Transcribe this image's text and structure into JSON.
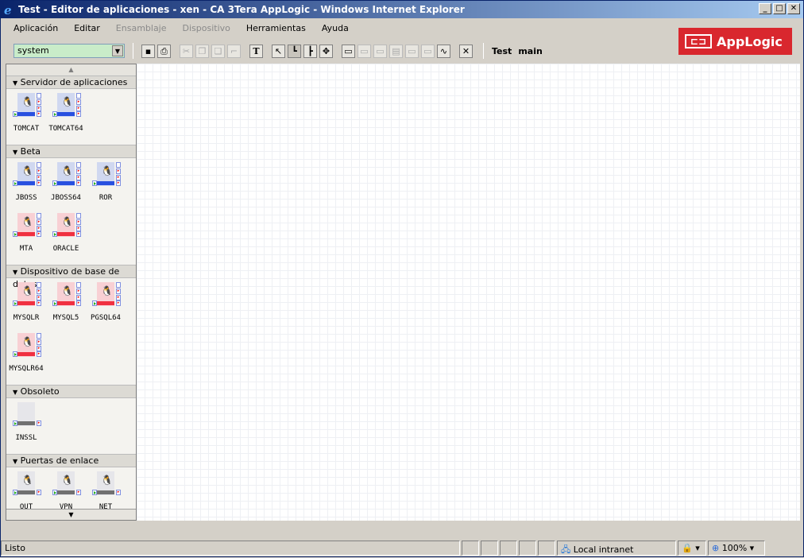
{
  "window": {
    "title": "Test - Editor de aplicaciones - xen - CA 3Tera AppLogic - Windows Internet Explorer",
    "minimize": "_",
    "maximize": "□",
    "close": "✕"
  },
  "menu": [
    {
      "label": "Aplicación",
      "enabled": true
    },
    {
      "label": "Editar",
      "enabled": true
    },
    {
      "label": "Ensamblaje",
      "enabled": false
    },
    {
      "label": "Dispositivo",
      "enabled": false
    },
    {
      "label": "Herramientas",
      "enabled": true
    },
    {
      "label": "Ayuda",
      "enabled": true
    }
  ],
  "logo": {
    "text": "AppLogic",
    "mark": "⊏⊟"
  },
  "toolbar": {
    "catalog_select": "system",
    "app_name": "Test",
    "assembly_name": "main"
  },
  "palette": {
    "sections": [
      {
        "title": "Servidor de aplicaciones",
        "items": [
          {
            "name": "TOMCAT",
            "color": "blue"
          },
          {
            "name": "TOMCAT64",
            "color": "blue"
          }
        ]
      },
      {
        "title": "Beta",
        "items": [
          {
            "name": "JBOSS",
            "color": "blue"
          },
          {
            "name": "JBOSS64",
            "color": "blue"
          },
          {
            "name": "ROR",
            "color": "blue"
          },
          {
            "name": "MTA",
            "color": "red"
          },
          {
            "name": "ORACLE",
            "color": "red"
          }
        ]
      },
      {
        "title": "Dispositivo de base de datos",
        "items": [
          {
            "name": "MYSQLR",
            "color": "red"
          },
          {
            "name": "MYSQL5",
            "color": "red"
          },
          {
            "name": "PGSQL64",
            "color": "red"
          },
          {
            "name": "MYSQLR64",
            "color": "red"
          }
        ]
      },
      {
        "title": "Obsoleto",
        "items": [
          {
            "name": "INSSL",
            "color": "gray"
          }
        ]
      },
      {
        "title": "Puertas de enlace",
        "items": [
          {
            "name": "OUT",
            "color": "gray"
          },
          {
            "name": "VPN",
            "color": "gray"
          },
          {
            "name": "NET",
            "color": "gray"
          }
        ]
      }
    ]
  },
  "colors": {
    "blue": [
      "#d0d8f0",
      "#2850e0"
    ],
    "red": [
      "#f8d0d4",
      "#f03040"
    ],
    "gray": [
      "#e6e6ea",
      "#707070"
    ]
  },
  "status": {
    "text": "Listo",
    "zone": "Local intranet",
    "zoom": "100%"
  }
}
